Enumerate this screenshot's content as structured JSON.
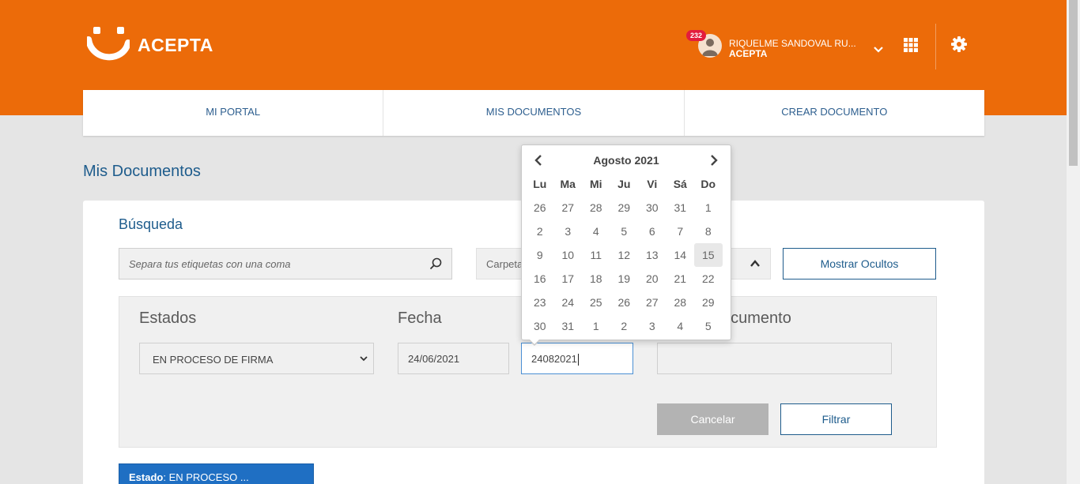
{
  "brand": {
    "name": "ACEPTA",
    "accent": "#ec6b09",
    "primary": "#1e5c8c"
  },
  "user": {
    "name": "RIQUELME SANDOVAL RU...",
    "org": "ACEPTA",
    "notifications": "232"
  },
  "nav": [
    {
      "label": "MI PORTAL"
    },
    {
      "label": "MIS DOCUMENTOS"
    },
    {
      "label": "CREAR DOCUMENTO"
    }
  ],
  "page_title": "Mis Documentos",
  "search": {
    "title": "Búsqueda",
    "tags_placeholder": "Separa tus etiquetas con una coma",
    "folder_value": "Carpeta",
    "show_hidden_label": "Mostrar Ocultos"
  },
  "filters": {
    "estados_label": "Estados",
    "estados_value": "EN PROCESO DE FIRMA",
    "fecha_label": "Fecha",
    "date_from": "24/06/2021",
    "date_to": "24082021",
    "documento_label": "ocumento",
    "documento_value": "",
    "cancel_label": "Cancelar",
    "filter_label": "Filtrar"
  },
  "estado_tag": {
    "key": "Estado",
    "value": ": EN PROCESO ..."
  },
  "datepicker": {
    "month_title": "Agosto 2021",
    "days_of_week": [
      "Lu",
      "Ma",
      "Mi",
      "Ju",
      "Vi",
      "Sá",
      "Do"
    ],
    "weeks": [
      [
        "26",
        "27",
        "28",
        "29",
        "30",
        "31",
        "1"
      ],
      [
        "2",
        "3",
        "4",
        "5",
        "6",
        "7",
        "8"
      ],
      [
        "9",
        "10",
        "11",
        "12",
        "13",
        "14",
        "15"
      ],
      [
        "16",
        "17",
        "18",
        "19",
        "20",
        "21",
        "22"
      ],
      [
        "23",
        "24",
        "25",
        "26",
        "27",
        "28",
        "29"
      ],
      [
        "30",
        "31",
        "1",
        "2",
        "3",
        "4",
        "5"
      ]
    ],
    "highlighted_day": "15"
  }
}
